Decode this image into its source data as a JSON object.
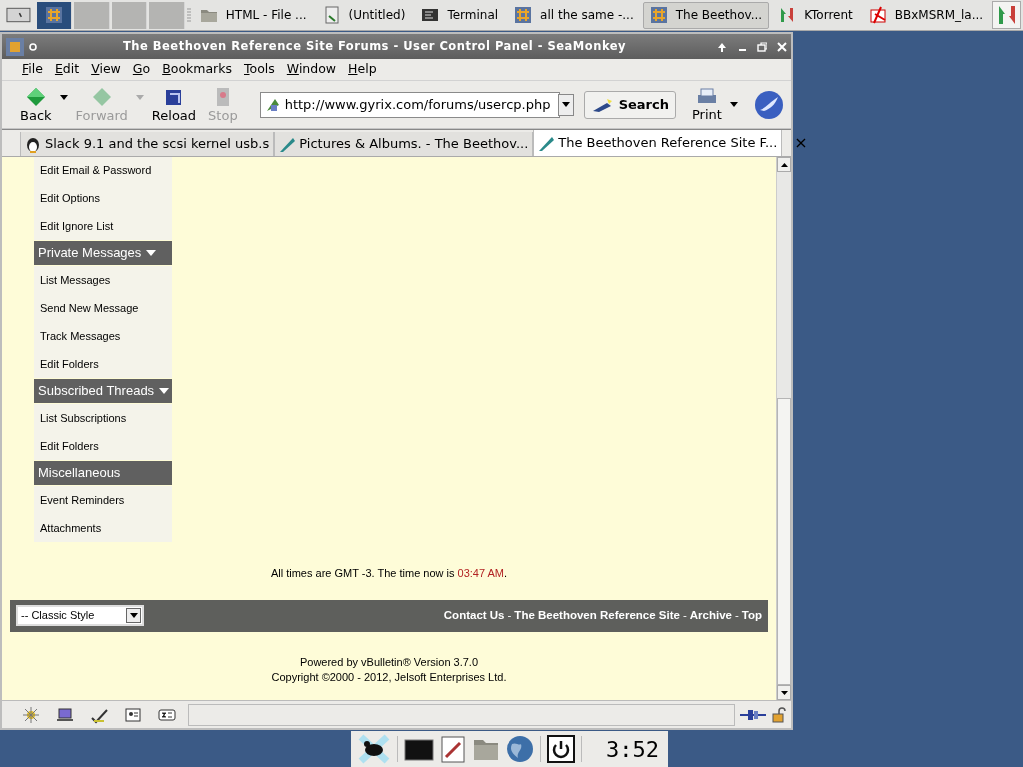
{
  "taskbar": {
    "pager": [
      {
        "selected": true
      },
      {
        "selected": false
      },
      {
        "selected": false
      },
      {
        "selected": false
      }
    ],
    "tasks": [
      {
        "label": "HTML - File ...",
        "kind": "folder",
        "selected": false
      },
      {
        "label": "(Untitled)",
        "kind": "editor",
        "selected": false
      },
      {
        "label": "Terminal",
        "kind": "terminal",
        "selected": false
      },
      {
        "label": "all the same -...",
        "kind": "browser",
        "selected": false
      },
      {
        "label": "The Beethov...",
        "kind": "browser",
        "selected": true
      },
      {
        "label": "KTorrent",
        "kind": "arrows",
        "selected": false
      },
      {
        "label": "BBxMSRM_la...",
        "kind": "pdf",
        "selected": false
      }
    ]
  },
  "window": {
    "title": "The Beethoven Reference Site Forums - User Control Panel - SeaMonkey",
    "menu": [
      "File",
      "Edit",
      "View",
      "Go",
      "Bookmarks",
      "Tools",
      "Window",
      "Help"
    ],
    "toolbar": [
      {
        "label": "Back",
        "kind": "back",
        "disabled": false,
        "dropdown": true
      },
      {
        "label": "Forward",
        "kind": "forward",
        "disabled": true,
        "dropdown": true
      },
      {
        "label": "Reload",
        "kind": "reload",
        "disabled": false,
        "dropdown": false
      },
      {
        "label": "Stop",
        "kind": "stop",
        "disabled": true,
        "dropdown": false
      }
    ],
    "url": "http://www.gyrix.com/forums/usercp.php",
    "search_button": "Search",
    "print_button": "Print",
    "tabs": [
      {
        "label": "Slack 9.1 and the scsi kernel usb.s",
        "kind": "penguin",
        "selected": false
      },
      {
        "label": "Pictures & Albums. - The Beethov...",
        "kind": "feather",
        "selected": false
      },
      {
        "label": "The Beethoven Reference Site F...",
        "kind": "feather",
        "selected": true
      }
    ],
    "close_tab": "×"
  },
  "sidebar": [
    {
      "kind": "link",
      "label": "Edit Email & Password"
    },
    {
      "kind": "link",
      "label": "Edit Options"
    },
    {
      "kind": "link",
      "label": "Edit Ignore List"
    },
    {
      "kind": "header",
      "label": "Private Messages",
      "collapsible": true
    },
    {
      "kind": "link",
      "label": "List Messages"
    },
    {
      "kind": "link",
      "label": "Send New Message"
    },
    {
      "kind": "link",
      "label": "Track Messages"
    },
    {
      "kind": "link",
      "label": "Edit Folders"
    },
    {
      "kind": "header",
      "label": "Subscribed Threads",
      "collapsible": true
    },
    {
      "kind": "link",
      "label": "List Subscriptions"
    },
    {
      "kind": "link",
      "label": "Edit Folders"
    },
    {
      "kind": "header",
      "label": "Miscellaneous",
      "collapsible": false
    },
    {
      "kind": "link",
      "label": "Event Reminders"
    },
    {
      "kind": "link",
      "label": "Attachments"
    }
  ],
  "time_note": {
    "before": "All times are GMT -3. The time now is ",
    "time": "03:47 AM",
    "after": "."
  },
  "footer": {
    "style_select": "-- Classic Style",
    "links": [
      "Contact Us",
      "The Beethoven Reference Site",
      "Archive",
      "Top"
    ],
    "separator": "-"
  },
  "credits": [
    "Powered by vBulletin® Version 3.7.0",
    "Copyright ©2000 - 2012, Jelsoft Enterprises Ltd."
  ],
  "dock": {
    "clock": "3:52"
  }
}
